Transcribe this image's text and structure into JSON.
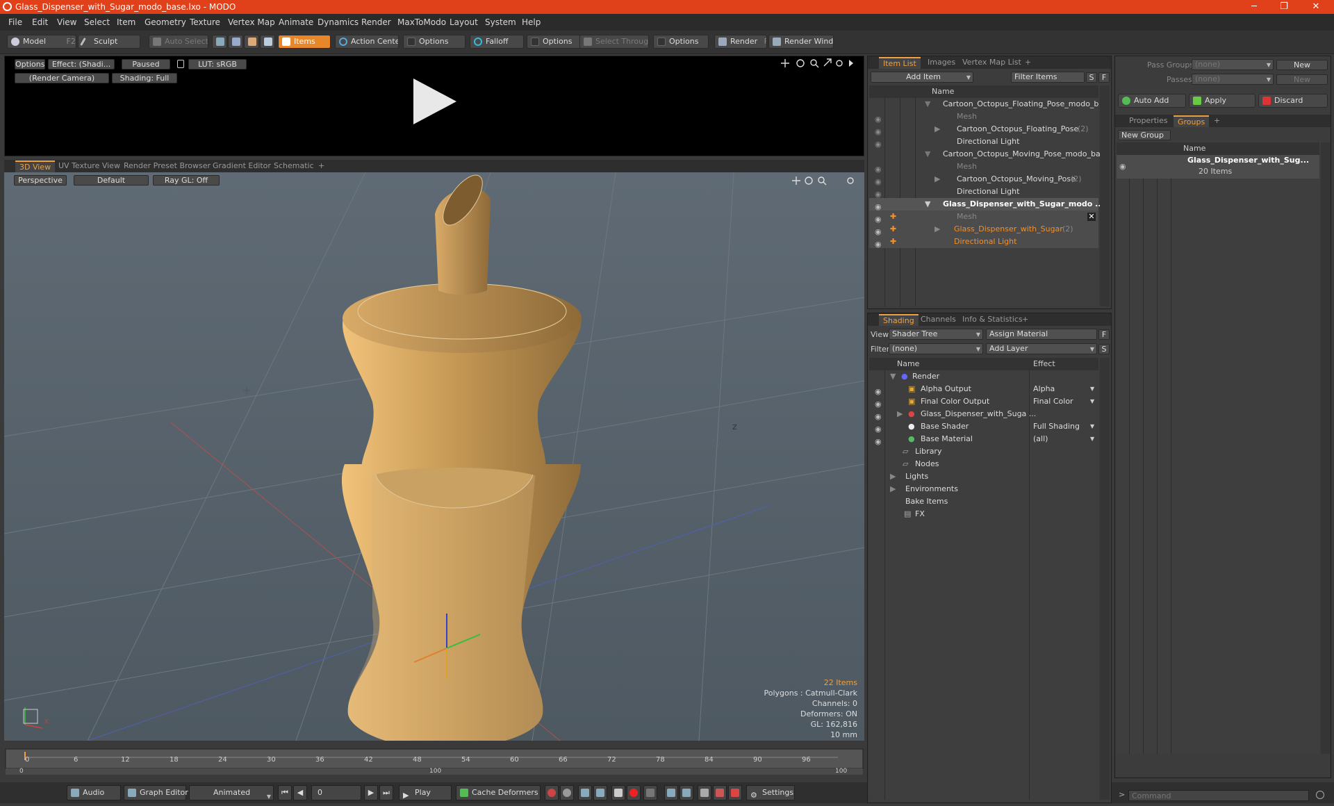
{
  "window": {
    "title": "Glass_Dispenser_with_Sugar_modo_base.lxo - MODO",
    "minimize": "─",
    "maximize": "❐",
    "close": "✕"
  },
  "menu": [
    "File",
    "Edit",
    "View",
    "Select",
    "Item",
    "Geometry",
    "Texture",
    "Vertex Map",
    "Animate",
    "Dynamics",
    "Render",
    "MaxToModo",
    "Layout",
    "System",
    "Help"
  ],
  "toolbar": {
    "model": "Model",
    "model_key": "F2",
    "sculpt": "Sculpt",
    "auto_select": "Auto Select",
    "items": "Items",
    "action_center": "Action Center",
    "options1": "Options",
    "falloff": "Falloff",
    "options2": "Options",
    "select_through": "Select Through",
    "options3": "Options",
    "render": "Render",
    "render_key": "F9",
    "render_window": "Render Window"
  },
  "preview": {
    "options": "Options",
    "effect": "Effect: (Shadi...",
    "paused": "Paused",
    "lut": "LUT: sRGB",
    "camera": "(Render Camera)",
    "shading": "Shading: Full"
  },
  "viewport_tabs": [
    "3D View",
    "UV Texture View",
    "Render Preset Browser",
    "Gradient Editor",
    "Schematic",
    "+"
  ],
  "viewport": {
    "perspective": "Perspective",
    "default": "Default",
    "raygl": "Ray GL: Off",
    "axis_x": "X",
    "axis_z": "Z",
    "stats": {
      "items": "22 Items",
      "polygons": "Polygons : Catmull-Clark",
      "channels": "Channels: 0",
      "deformers": "Deformers: ON",
      "gl": "GL: 162,816",
      "scale": "10 mm"
    }
  },
  "timeline": {
    "ticks": [
      "0",
      "6",
      "12",
      "18",
      "24",
      "30",
      "36",
      "42",
      "48",
      "54",
      "60",
      "66",
      "72",
      "78",
      "84",
      "90",
      "96"
    ],
    "lower": [
      "0",
      "100",
      "100"
    ]
  },
  "bottom": {
    "audio": "Audio",
    "graph_editor": "Graph Editor",
    "animated": "Animated",
    "frame": "0",
    "play": "Play",
    "cache_deformers": "Cache Deformers",
    "settings": "Settings"
  },
  "itemlist": {
    "tabs": [
      "Item List",
      "Images",
      "Vertex Map List",
      "+"
    ],
    "add_item": "Add Item",
    "filter_items": "Filter Items",
    "s": "S",
    "f": "F",
    "name_header": "Name",
    "rows": [
      {
        "label": "Cartoon_Octopus_Floating_Pose_modo_b ...",
        "count": ""
      },
      {
        "label": "Mesh",
        "count": ""
      },
      {
        "label": "Cartoon_Octopus_Floating_Pose",
        "count": "(2)"
      },
      {
        "label": "Directional Light",
        "count": ""
      },
      {
        "label": "Cartoon_Octopus_Moving_Pose_modo_ba ...",
        "count": ""
      },
      {
        "label": "Mesh",
        "count": ""
      },
      {
        "label": "Cartoon_Octopus_Moving_Pose",
        "count": "(2)"
      },
      {
        "label": "Directional Light",
        "count": ""
      },
      {
        "label": "Glass_Dispenser_with_Sugar_modo ...",
        "count": ""
      },
      {
        "label": "Mesh",
        "count": ""
      },
      {
        "label": "Glass_Dispenser_with_Sugar",
        "count": "(2)"
      },
      {
        "label": "Directional Light",
        "count": ""
      }
    ]
  },
  "shading": {
    "tabs": [
      "Shading",
      "Channels",
      "Info & Statistics",
      "+"
    ],
    "view_label": "View",
    "view_value": "Shader Tree",
    "assign_material": "Assign Material",
    "f": "F",
    "filter_label": "Filter",
    "filter_value": "(none)",
    "add_layer": "Add Layer",
    "s": "S",
    "name_header": "Name",
    "effect_header": "Effect",
    "rows": [
      {
        "name": "Render",
        "effect": ""
      },
      {
        "name": "Alpha Output",
        "effect": "Alpha"
      },
      {
        "name": "Final Color Output",
        "effect": "Final Color"
      },
      {
        "name": "Glass_Dispenser_with_Suga ...",
        "effect": ""
      },
      {
        "name": "Base Shader",
        "effect": "Full Shading"
      },
      {
        "name": "Base Material",
        "effect": "(all)"
      },
      {
        "name": "Library",
        "effect": ""
      },
      {
        "name": "Nodes",
        "effect": ""
      },
      {
        "name": "Lights",
        "effect": ""
      },
      {
        "name": "Environments",
        "effect": ""
      },
      {
        "name": "Bake Items",
        "effect": ""
      },
      {
        "name": "FX",
        "effect": ""
      }
    ]
  },
  "groups": {
    "pass_groups_label": "Pass Groups",
    "pass_groups_value": "(none)",
    "passes_label": "Passes",
    "passes_value": "(none)",
    "new1": "New",
    "new2": "New",
    "auto_add": "Auto Add",
    "apply": "Apply",
    "discard": "Discard",
    "tabs": [
      "Properties",
      "Groups",
      "+"
    ],
    "new_group": "New Group",
    "name_header": "Name",
    "group_name": "Glass_Dispenser_with_Sug...",
    "group_count": "20 Items"
  },
  "command_placeholder": "Command",
  "colors": {
    "accent": "#f0a040",
    "titlebar": "#e0401a",
    "selected_orange": "#f09030"
  }
}
